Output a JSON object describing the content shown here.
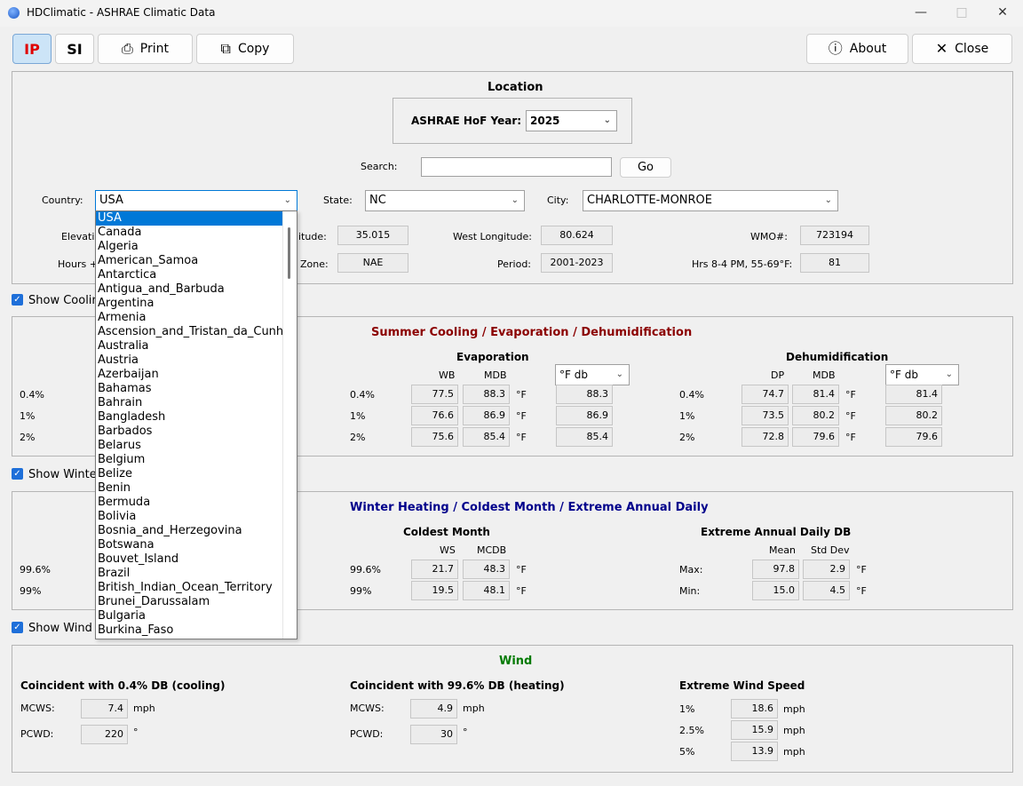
{
  "window": {
    "title": "HDClimatic - ASHRAE Climatic Data"
  },
  "toolbar": {
    "ip": "IP",
    "si": "SI",
    "print": "Print",
    "copy": "Copy",
    "about": "About",
    "close": "Close"
  },
  "location": {
    "heading": "Location",
    "hof_label": "ASHRAE HoF Year:",
    "hof_value": "2025",
    "search_label": "Search:",
    "search_value": "",
    "go": "Go",
    "country_label": "Country:",
    "country_value": "USA",
    "state_label": "State:",
    "state_value": "NC",
    "city_label": "City:",
    "city_value": "CHARLOTTE-MONROE",
    "elevation_label": "Elevatio",
    "hours_label": "Hours +",
    "latitude_label": "itude:",
    "latitude_value": "35.015",
    "zone_label": "Zone:",
    "zone_value": "NAE",
    "lon_label": "West Longitude:",
    "lon_value": "80.624",
    "period_label": "Period:",
    "period_value": "2001-2023",
    "wmo_label": "WMO#:",
    "wmo_value": "723194",
    "hrs_label": "Hrs 8-4 PM, 55-69°F:",
    "hrs_value": "81"
  },
  "country_list": [
    "USA",
    "Canada",
    "Algeria",
    "American_Samoa",
    "Antarctica",
    "Antigua_and_Barbuda",
    "Argentina",
    "Armenia",
    "Ascension_and_Tristan_da_Cunha",
    "Australia",
    "Austria",
    "Azerbaijan",
    "Bahamas",
    "Bahrain",
    "Bangladesh",
    "Barbados",
    "Belarus",
    "Belgium",
    "Belize",
    "Benin",
    "Bermuda",
    "Bolivia",
    "Bosnia_and_Herzegovina",
    "Botswana",
    "Bouvet_Island",
    "Brazil",
    "British_Indian_Ocean_Territory",
    "Brunei_Darussalam",
    "Bulgaria",
    "Burkina_Faso"
  ],
  "cooling": {
    "show_label": "Show Coolin",
    "heading": "Summer Cooling / Evaporation / Dehumidification",
    "rows_left": [
      "0.4%",
      "1%",
      "2%"
    ],
    "evap": {
      "heading": "Evaporation",
      "col1": "WB",
      "col2": "MDB",
      "unit": "°F",
      "dropdown": "°F db",
      "rows": [
        {
          "p": "0.4%",
          "a": "77.5",
          "b": "88.3",
          "c": "88.3"
        },
        {
          "p": "1%",
          "a": "76.6",
          "b": "86.9",
          "c": "86.9"
        },
        {
          "p": "2%",
          "a": "75.6",
          "b": "85.4",
          "c": "85.4"
        }
      ]
    },
    "dehum": {
      "heading": "Dehumidification",
      "col1": "DP",
      "col2": "MDB",
      "unit": "°F",
      "dropdown": "°F db",
      "rows": [
        {
          "p": "0.4%",
          "a": "74.7",
          "b": "81.4",
          "c": "81.4"
        },
        {
          "p": "1%",
          "a": "73.5",
          "b": "80.2",
          "c": "80.2"
        },
        {
          "p": "2%",
          "a": "72.8",
          "b": "79.6",
          "c": "79.6"
        }
      ]
    }
  },
  "winter": {
    "show_label": "Show Winte",
    "heading": "Winter Heating / Coldest Month / Extreme Annual Daily",
    "rows_left": [
      "99.6%",
      "99%"
    ],
    "coldest": {
      "heading": "Coldest Month",
      "col1": "WS",
      "col2": "MCDB",
      "unit": "°F",
      "rows": [
        {
          "p": "99.6%",
          "a": "21.7",
          "b": "48.3"
        },
        {
          "p": "99%",
          "a": "19.5",
          "b": "48.1"
        }
      ]
    },
    "extreme": {
      "heading": "Extreme Annual Daily DB",
      "col1": "Mean",
      "col2": "Std Dev",
      "unit": "°F",
      "rows": [
        {
          "p": "Max:",
          "a": "97.8",
          "b": "2.9"
        },
        {
          "p": "Min:",
          "a": "15.0",
          "b": "4.5"
        }
      ]
    }
  },
  "wind": {
    "show_label": "Show Wind",
    "heading": "Wind",
    "cool": {
      "heading": "Coincident with 0.4% DB (cooling)",
      "mcws_label": "MCWS:",
      "mcws": "7.4",
      "mcws_unit": "mph",
      "pcwd_label": "PCWD:",
      "pcwd": "220",
      "pcwd_unit": "°"
    },
    "heat": {
      "heading": "Coincident with 99.6% DB (heating)",
      "mcws_label": "MCWS:",
      "mcws": "4.9",
      "mcws_unit": "mph",
      "pcwd_label": "PCWD:",
      "pcwd": "30",
      "pcwd_unit": "°"
    },
    "extreme": {
      "heading": "Extreme Wind Speed",
      "rows": [
        {
          "p": "1%",
          "v": "18.6",
          "u": "mph"
        },
        {
          "p": "2.5%",
          "v": "15.9",
          "u": "mph"
        },
        {
          "p": "5%",
          "v": "13.9",
          "u": "mph"
        }
      ]
    }
  },
  "colors": {
    "cooling_heading": "#8b0000",
    "winter_heading": "#00008b",
    "wind_heading": "#007a00",
    "accent": "#0078d7"
  }
}
